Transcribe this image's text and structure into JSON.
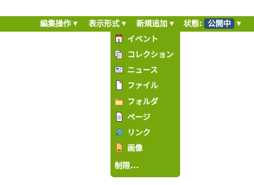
{
  "toolbar": {
    "edit_label": "編集操作",
    "view_label": "表示形式",
    "add_label": "新規追加",
    "state_label": "状態:",
    "state_value": "公開中",
    "arrow": "▼"
  },
  "add_menu": {
    "items": [
      {
        "label": "イベント",
        "icon": "calendar-icon"
      },
      {
        "label": "コレクション",
        "icon": "collection-icon"
      },
      {
        "label": "ニュース",
        "icon": "news-icon"
      },
      {
        "label": "ファイル",
        "icon": "file-icon"
      },
      {
        "label": "フォルダ",
        "icon": "folder-icon"
      },
      {
        "label": "ページ",
        "icon": "page-icon"
      },
      {
        "label": "リンク",
        "icon": "link-icon"
      },
      {
        "label": "画像",
        "icon": "image-icon"
      }
    ],
    "restrictions_label": "制限..."
  },
  "colors": {
    "toolbar_bg": "#76a80d",
    "badge_bg": "#2f5375",
    "text": "#ffffff"
  }
}
